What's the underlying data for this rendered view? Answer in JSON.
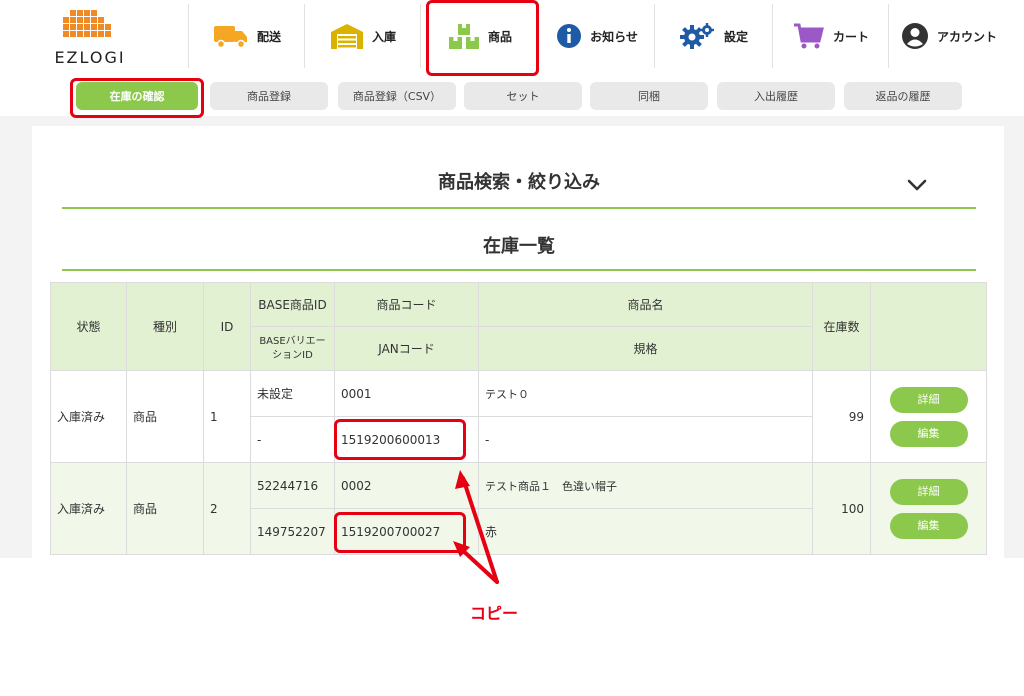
{
  "header": {
    "logo_text": "EZLOGI",
    "nav": [
      {
        "label": "配送",
        "icon": "truck-icon"
      },
      {
        "label": "入庫",
        "icon": "warehouse-icon"
      },
      {
        "label": "商品",
        "icon": "boxes-icon"
      },
      {
        "label": "お知らせ",
        "icon": "info-icon"
      },
      {
        "label": "設定",
        "icon": "gear-icon"
      },
      {
        "label": "カート",
        "icon": "cart-icon"
      },
      {
        "label": "アカウント",
        "icon": "account-icon"
      }
    ]
  },
  "subtabs": [
    {
      "label": "在庫の確認",
      "active": true
    },
    {
      "label": "商品登録"
    },
    {
      "label": "商品登録（CSV）"
    },
    {
      "label": "セット"
    },
    {
      "label": "同梱"
    },
    {
      "label": "入出履歴"
    },
    {
      "label": "返品の履歴"
    }
  ],
  "search": {
    "title": "商品検索・絞り込み"
  },
  "inventory": {
    "title": "在庫一覧"
  },
  "table": {
    "headers": {
      "status": "状態",
      "type": "種別",
      "id": "ID",
      "base_id": "BASE商品ID",
      "base_variation_id": "BASEバリエーションID",
      "product_code": "商品コード",
      "jan_code": "JANコード",
      "product_name": "商品名",
      "spec": "規格",
      "stock": "在庫数"
    },
    "rows": [
      {
        "status": "入庫済み",
        "type": "商品",
        "id": "1",
        "base_id": "未設定",
        "base_variation_id": "-",
        "product_code": "0001",
        "jan_code": "1519200600013",
        "product_name": "テスト０",
        "spec": "-",
        "stock": "99",
        "detail_label": "詳細",
        "edit_label": "編集"
      },
      {
        "status": "入庫済み",
        "type": "商品",
        "id": "2",
        "base_id": "52244716",
        "base_variation_id": "149752207",
        "product_code": "0002",
        "jan_code": "1519200700027",
        "product_name": "テスト商品１　色違い帽子",
        "spec": "赤",
        "stock": "100",
        "detail_label": "詳細",
        "edit_label": "編集"
      }
    ]
  },
  "annotation": {
    "label": "コピー",
    "color": "#e60012"
  },
  "colors": {
    "accent": "#8cc84b",
    "header_bg": "#e3f1d3",
    "highlight": "#e60012"
  }
}
